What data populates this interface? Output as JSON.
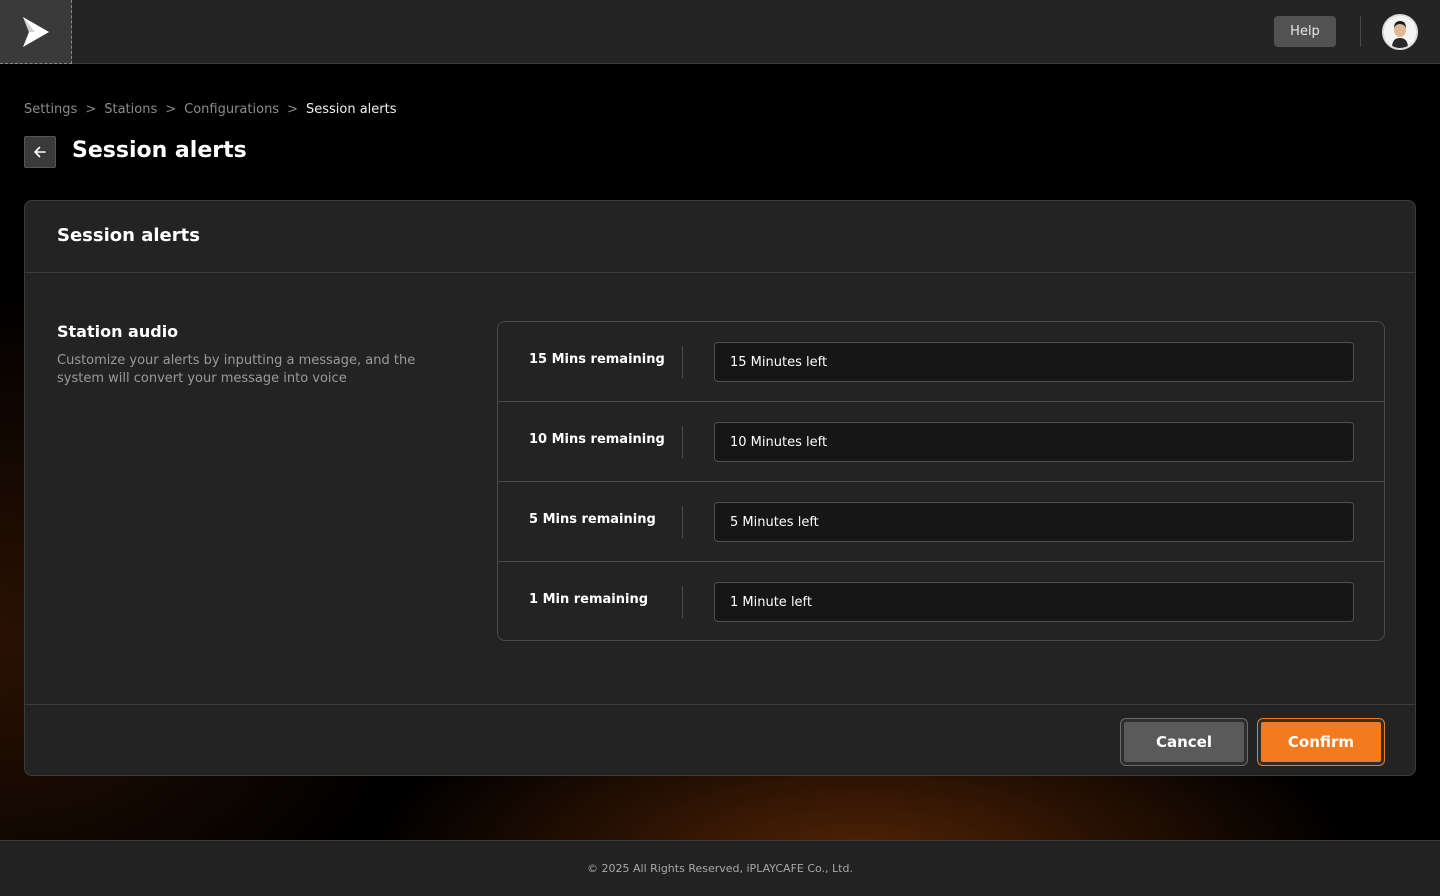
{
  "topbar": {
    "help_label": "Help",
    "logo_icon": "play-logo-icon",
    "avatar_icon": "user-avatar-icon"
  },
  "breadcrumb": {
    "items": [
      "Settings",
      "Stations",
      "Configurations"
    ],
    "separator": ">",
    "current": "Session alerts"
  },
  "page": {
    "title": "Session alerts",
    "back_icon": "arrow-left-icon"
  },
  "card": {
    "title": "Session alerts",
    "section": {
      "title": "Station audio",
      "description": "Customize your alerts by inputting a message, and the system will convert your message into voice"
    },
    "alerts": [
      {
        "label": "15 Mins remaining",
        "value": "15 Minutes left"
      },
      {
        "label": "10 Mins remaining",
        "value": "10 Minutes left"
      },
      {
        "label": "5 Mins remaining",
        "value": "5 Minutes left"
      },
      {
        "label": "1 Min remaining",
        "value": "1 Minute left"
      }
    ],
    "cancel_label": "Cancel",
    "confirm_label": "Confirm"
  },
  "footer": {
    "copyright": "© 2025 All Rights Reserved, iPLAYCAFE Co., Ltd."
  },
  "colors": {
    "accent": "#f47a20",
    "background": "#000000",
    "surface": "#242424"
  }
}
